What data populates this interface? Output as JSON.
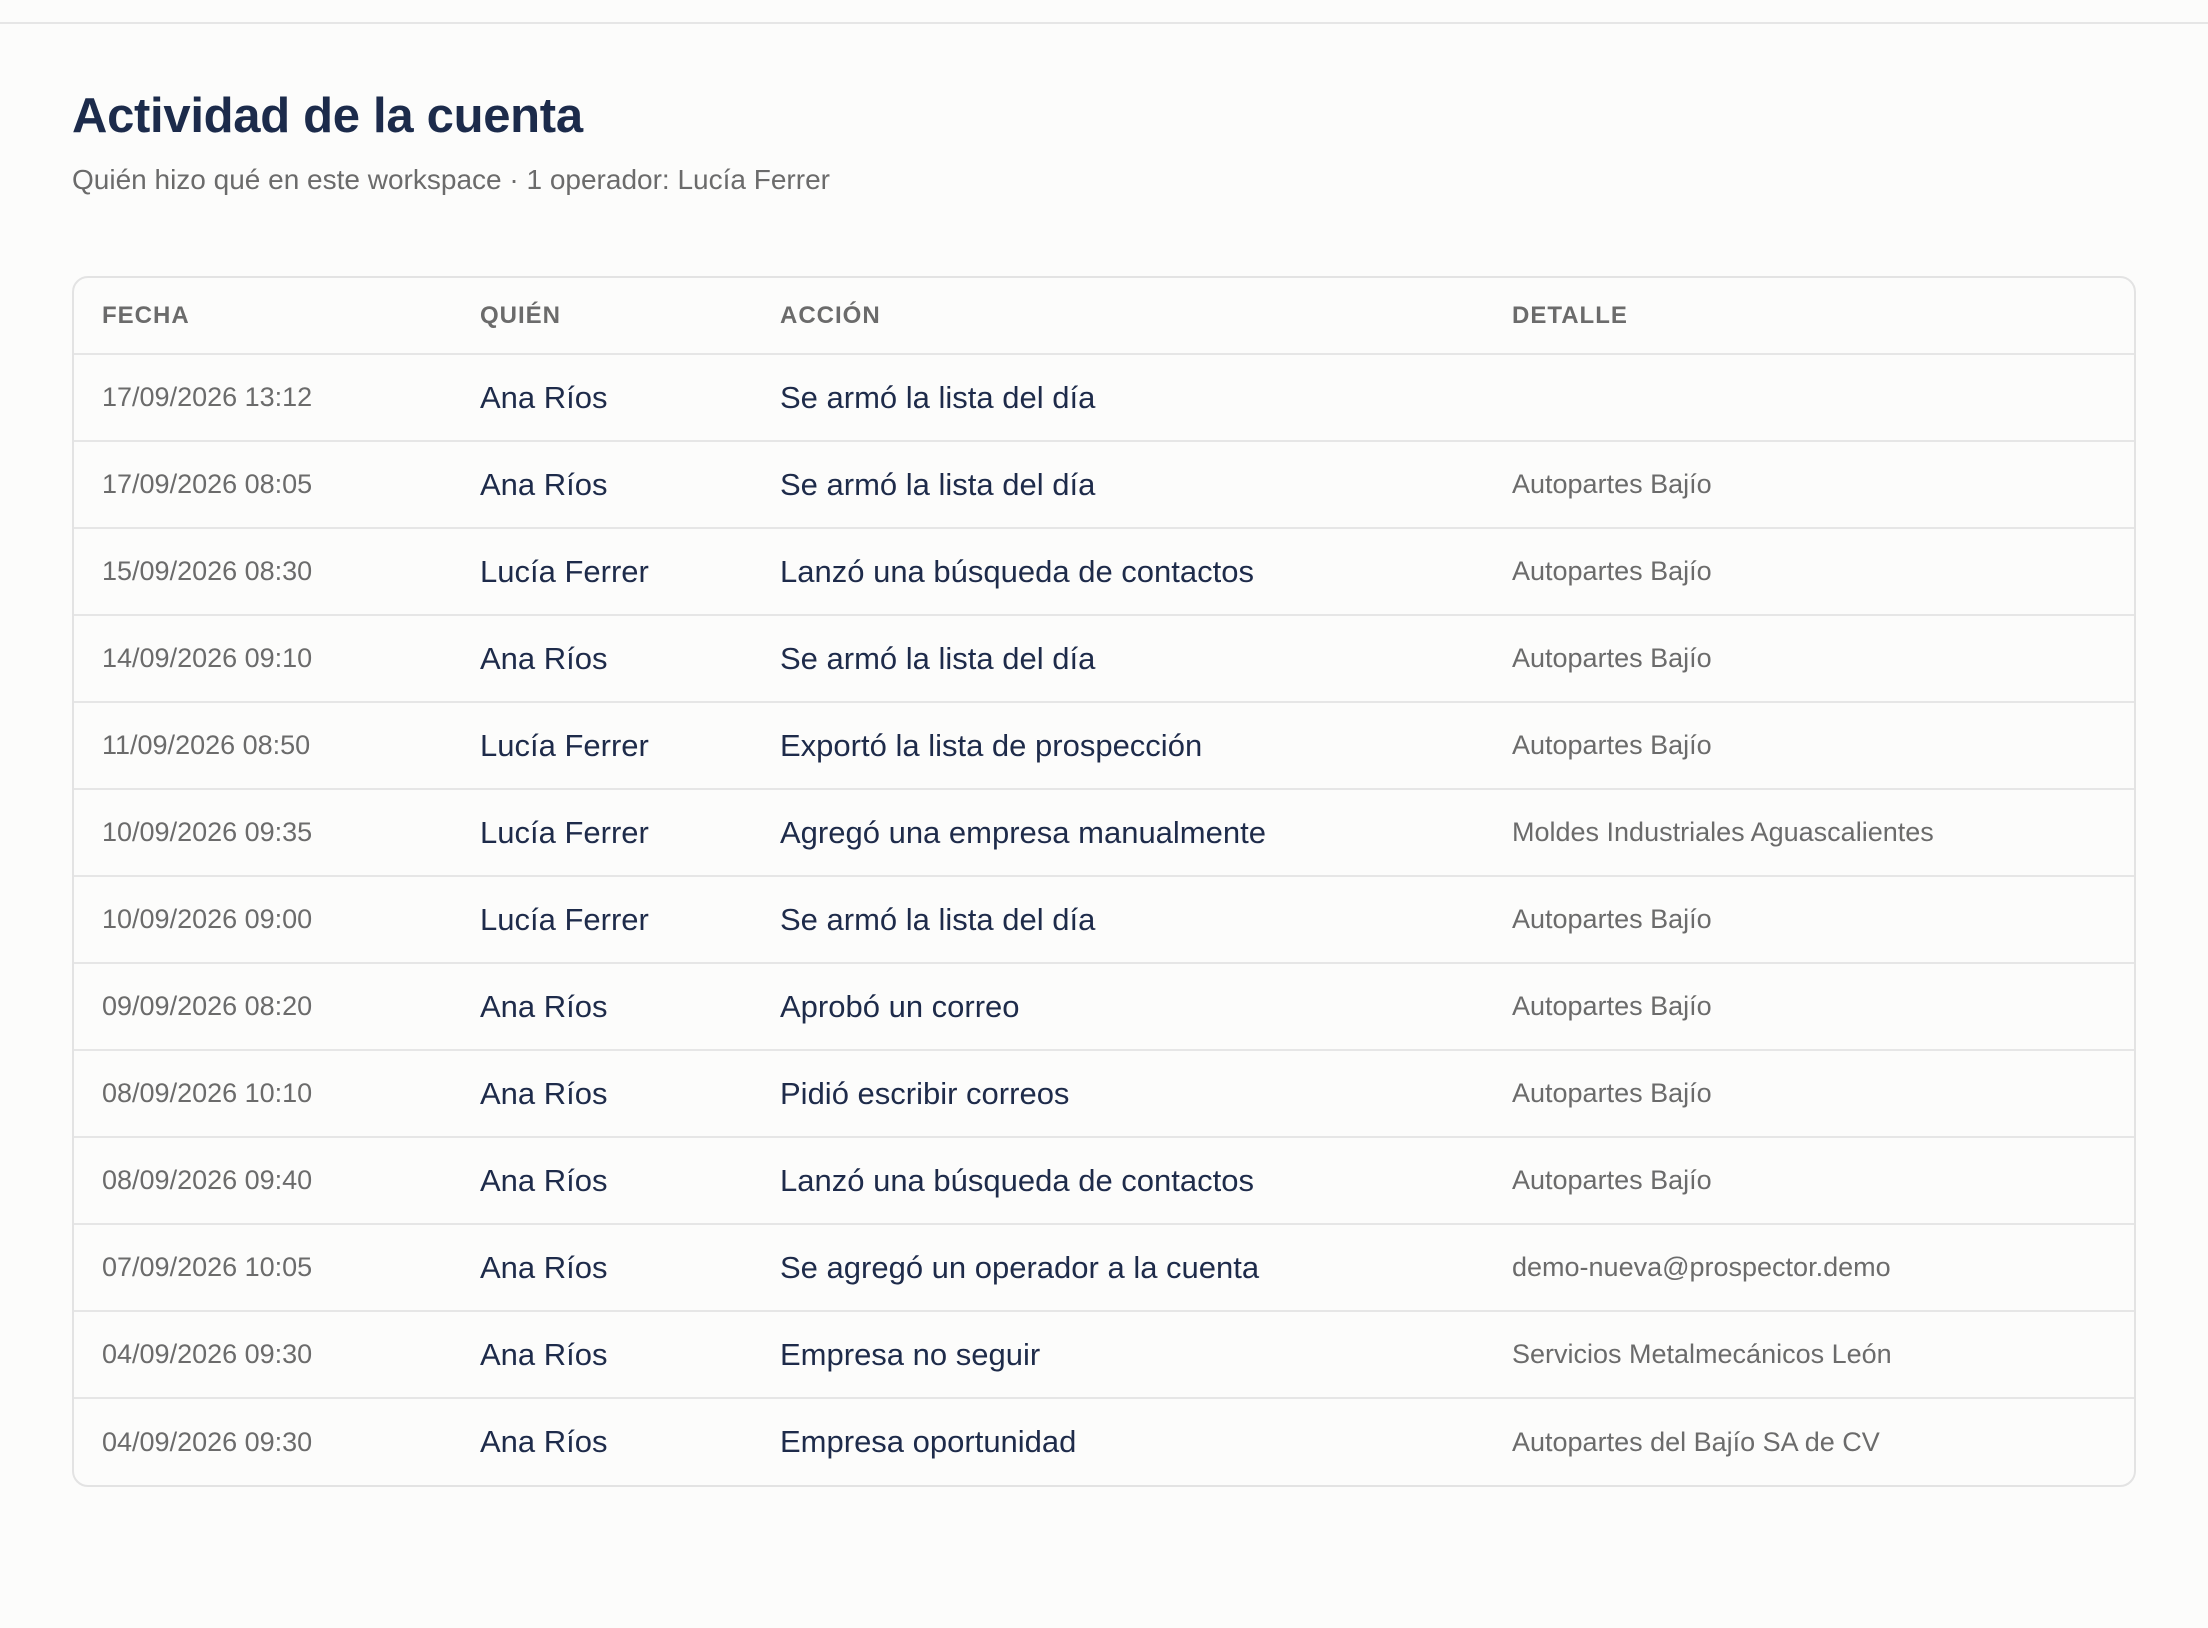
{
  "header": {
    "title": "Actividad de la cuenta",
    "subtitle": "Quién hizo qué en este workspace · 1 operador: Lucía Ferrer"
  },
  "table": {
    "columns": [
      "FECHA",
      "QUIÉN",
      "ACCIÓN",
      "DETALLE"
    ],
    "rows": [
      {
        "fecha": "17/09/2026 13:12",
        "quien": "Ana Ríos",
        "accion": "Se armó la lista del día",
        "detalle": ""
      },
      {
        "fecha": "17/09/2026 08:05",
        "quien": "Ana Ríos",
        "accion": "Se armó la lista del día",
        "detalle": "Autopartes Bajío"
      },
      {
        "fecha": "15/09/2026 08:30",
        "quien": "Lucía Ferrer",
        "accion": "Lanzó una búsqueda de contactos",
        "detalle": "Autopartes Bajío"
      },
      {
        "fecha": "14/09/2026 09:10",
        "quien": "Ana Ríos",
        "accion": "Se armó la lista del día",
        "detalle": "Autopartes Bajío"
      },
      {
        "fecha": "11/09/2026 08:50",
        "quien": "Lucía Ferrer",
        "accion": "Exportó la lista de prospección",
        "detalle": "Autopartes Bajío"
      },
      {
        "fecha": "10/09/2026 09:35",
        "quien": "Lucía Ferrer",
        "accion": "Agregó una empresa manualmente",
        "detalle": "Moldes Industriales Aguascalientes"
      },
      {
        "fecha": "10/09/2026 09:00",
        "quien": "Lucía Ferrer",
        "accion": "Se armó la lista del día",
        "detalle": "Autopartes Bajío"
      },
      {
        "fecha": "09/09/2026 08:20",
        "quien": "Ana Ríos",
        "accion": "Aprobó un correo",
        "detalle": "Autopartes Bajío"
      },
      {
        "fecha": "08/09/2026 10:10",
        "quien": "Ana Ríos",
        "accion": "Pidió escribir correos",
        "detalle": "Autopartes Bajío"
      },
      {
        "fecha": "08/09/2026 09:40",
        "quien": "Ana Ríos",
        "accion": "Lanzó una búsqueda de contactos",
        "detalle": "Autopartes Bajío"
      },
      {
        "fecha": "07/09/2026 10:05",
        "quien": "Ana Ríos",
        "accion": "Se agregó un operador a la cuenta",
        "detalle": "demo-nueva@prospector.demo"
      },
      {
        "fecha": "04/09/2026 09:30",
        "quien": "Ana Ríos",
        "accion": "Empresa no seguir",
        "detalle": "Servicios Metalmecánicos León"
      },
      {
        "fecha": "04/09/2026 09:30",
        "quien": "Ana Ríos",
        "accion": "Empresa oportunidad",
        "detalle": "Autopartes del Bajío SA de CV"
      }
    ]
  }
}
